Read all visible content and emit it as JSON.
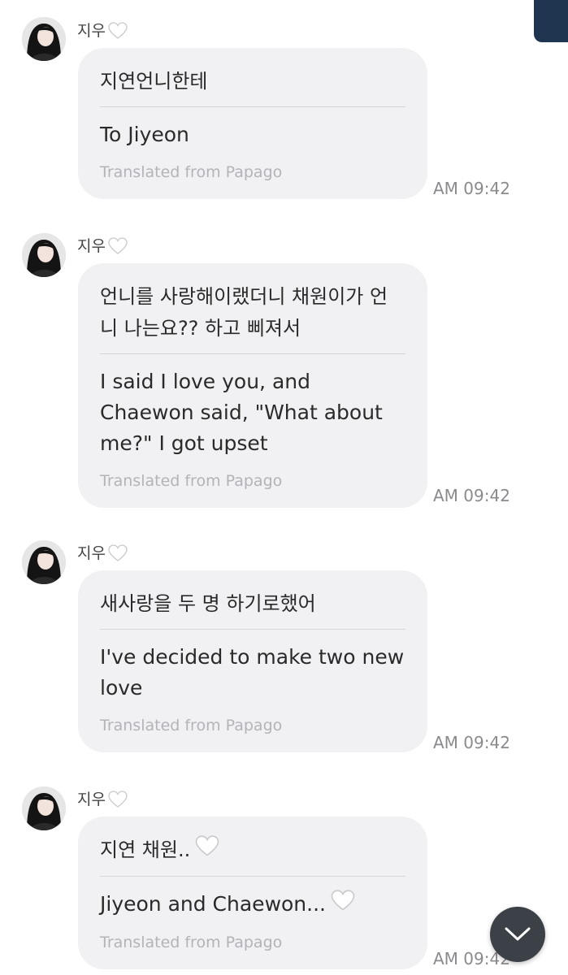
{
  "messages": [
    {
      "sender": "지우",
      "original": "지연언니한테",
      "translated": "To Jiyeon",
      "source": "Translated from Papago",
      "time": "AM 09:42"
    },
    {
      "sender": "지우",
      "original": "언니를 사랑해이랬더니 채원이가 언니 나는요?? 하고 삐져서",
      "translated": "I said I love you, and Chaewon said, \"What about me?\" I got upset",
      "source": "Translated from Papago",
      "time": "AM 09:42"
    },
    {
      "sender": "지우",
      "original": "새사랑을 두 명 하기로했어",
      "translated": "I've decided to make two new love",
      "source": "Translated from Papago",
      "time": "AM 09:42"
    },
    {
      "sender": "지우",
      "original": "지연 채원..",
      "translated": "Jiyeon and Chaewon...",
      "source": "Translated from Papago",
      "time": "AM 09:42"
    }
  ],
  "icons": {
    "sender_heart": "white-heart-icon",
    "scroll_down": "chevron-down-icon"
  },
  "colors": {
    "bubble": "#f1f1f3",
    "source_text": "#b3b3b8",
    "time_text": "#8a8a8f",
    "scroll_button": "#3c4047"
  }
}
